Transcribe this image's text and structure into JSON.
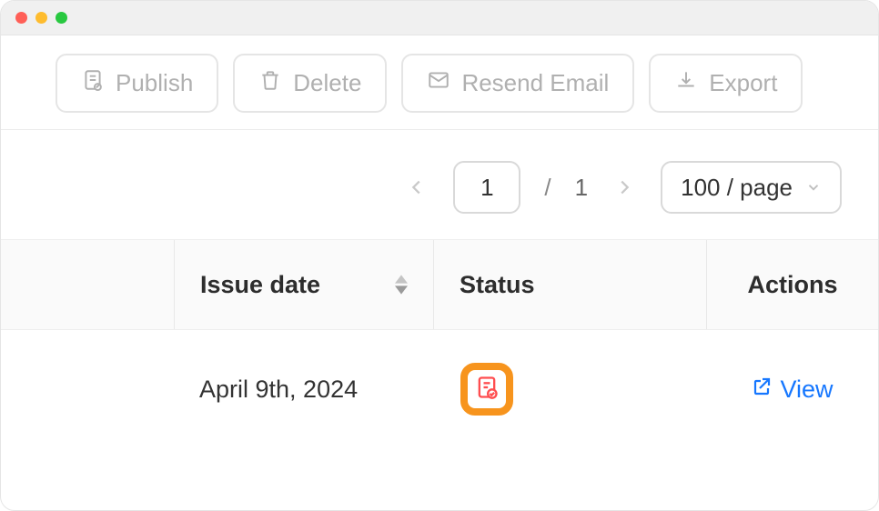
{
  "toolbar": {
    "publish_label": "Publish",
    "delete_label": "Delete",
    "resend_email_label": "Resend Email",
    "export_label": "Export"
  },
  "pagination": {
    "current_page": "1",
    "separator": "/",
    "total_pages": "1",
    "page_size_label": "100 / page"
  },
  "table": {
    "headers": {
      "issue_date": "Issue date",
      "status": "Status",
      "actions": "Actions"
    },
    "rows": [
      {
        "issue_date": "April 9th, 2024",
        "view_label": "View"
      }
    ]
  },
  "colors": {
    "highlight": "#f7941d",
    "link": "#1677ff",
    "red": "#ff4d4f",
    "green": "#52c41a",
    "grey": "#c0c0c0"
  }
}
